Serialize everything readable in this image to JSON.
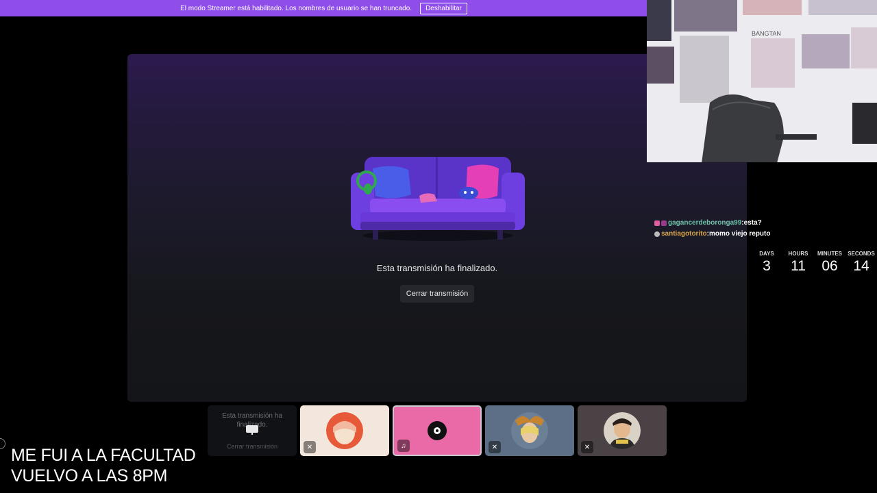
{
  "banner": {
    "message": "El modo Streamer está habilitado. Los nombres de usuario se han truncado.",
    "button_label": "Deshabilitar",
    "color": "#8f4eea"
  },
  "stage": {
    "ended_message": "Esta transmisión ha finalizado.",
    "close_button_label": "Cerrar transmisión"
  },
  "chat": {
    "messages": [
      {
        "user": "gagancerdeboronga99",
        "separator": ": ",
        "text": "esta?",
        "user_color": "#6ec2a9"
      },
      {
        "user": "santiagotorito",
        "separator": ": ",
        "text": "momo viejo reputo",
        "user_color": "#d9a64b"
      }
    ]
  },
  "countdown": {
    "days_label": "DAYS",
    "days": "3",
    "hours_label": "HOURS",
    "hours": "11",
    "minutes_label": "MINUTES",
    "minutes": "06",
    "seconds_label": "SECONDS",
    "seconds": "14"
  },
  "tiles": {
    "stream_tile_message": "Esta transmisión ha finalizado.",
    "stream_tile_close": "Cerrar transmisión",
    "participants": [
      {
        "icon": "mic-muted-icon",
        "background": "#f3e6dc"
      },
      {
        "icon": "headset-icon",
        "background": "#e96aa6",
        "active": true
      },
      {
        "icon": "mic-muted-icon",
        "background": "#5d6f86"
      },
      {
        "icon": "mic-muted-icon",
        "background": "#4a4245"
      }
    ]
  },
  "overlay": {
    "line1": "ME FUI A LA FACULTAD",
    "line2": "VUELVO A LAS 8PM"
  }
}
